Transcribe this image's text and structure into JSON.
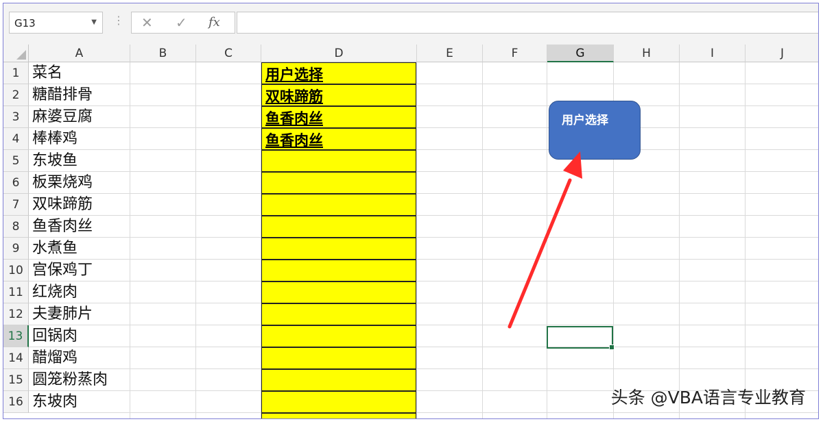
{
  "formula_bar": {
    "name_box": "G13",
    "cancel_icon": "✕",
    "enter_icon": "✓",
    "fx_label": "fx",
    "formula": ""
  },
  "columns": [
    "A",
    "B",
    "C",
    "D",
    "E",
    "F",
    "G",
    "H",
    "I",
    "J"
  ],
  "rows": [
    "1",
    "2",
    "3",
    "4",
    "5",
    "6",
    "7",
    "8",
    "9",
    "10",
    "11",
    "12",
    "13",
    "14",
    "15",
    "16"
  ],
  "column_a": [
    "菜名",
    "糖醋排骨",
    "麻婆豆腐",
    "棒棒鸡",
    "东坡鱼",
    "板栗烧鸡",
    "双味蹄筋",
    "鱼香肉丝",
    "水煮鱼",
    "宫保鸡丁",
    "红烧肉",
    "夫妻肺片",
    "回锅肉",
    "醋熘鸡",
    "圆笼粉蒸肉",
    "东坡肉"
  ],
  "column_d": [
    "用户选择",
    "双味蹄筋",
    "鱼香肉丝",
    "鱼香肉丝"
  ],
  "selected_cell": "G13",
  "shape": {
    "text": "用户选择",
    "fill": "#4472c4"
  },
  "arrow_color": "#ff2b2b",
  "watermark": "头条 @VBA语言专业教育",
  "colors": {
    "highlight": "#ffff00",
    "selection": "#217346"
  }
}
